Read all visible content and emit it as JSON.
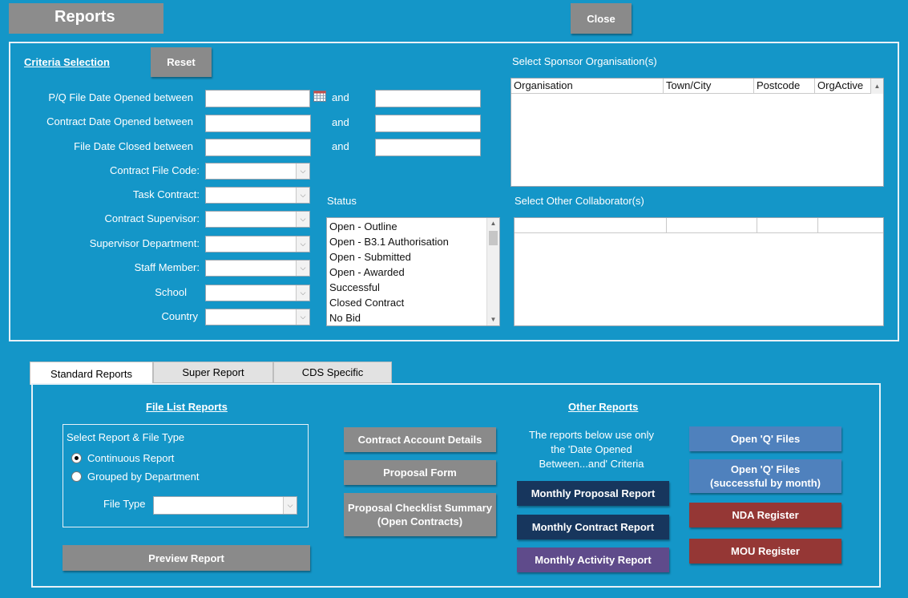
{
  "window": {
    "title": "Reports",
    "close_label": "Close"
  },
  "criteria": {
    "title": "Criteria Selection",
    "reset_label": "Reset",
    "fields": {
      "pq_date": "P/Q File Date Opened between",
      "contract_date": "Contract Date Opened between",
      "closed_date": "File Date Closed between",
      "and": "and",
      "contract_file_code": "Contract File Code:",
      "task_contract": "Task Contract:",
      "contract_supervisor": "Contract Supervisor:",
      "supervisor_department": "Supervisor Department:",
      "staff_member": "Staff Member:",
      "school": "School",
      "country": "Country"
    },
    "status": {
      "label": "Status",
      "items": [
        "Open - Outline",
        "Open - B3.1 Authorisation",
        "Open - Submitted",
        "Open - Awarded",
        "Successful",
        "Closed Contract",
        "No Bid"
      ]
    },
    "sponsor": {
      "label": "Select Sponsor Organisation(s)",
      "columns": [
        "Organisation",
        "Town/City",
        "Postcode",
        "OrgActive"
      ]
    },
    "collaborator": {
      "label": "Select Other Collaborator(s)"
    }
  },
  "tabs": [
    "Standard Reports",
    "Super Report",
    "CDS Specific"
  ],
  "file_list": {
    "title": "File List Reports",
    "group_label": "Select Report & File Type",
    "options": [
      "Continuous Report",
      "Grouped by Department"
    ],
    "file_type_label": "File Type",
    "preview_label": "Preview Report"
  },
  "middle_buttons": {
    "contract_account": "Contract Account Details",
    "proposal_form": "Proposal Form",
    "checklist_line1": "Proposal Checklist Summary",
    "checklist_line2": "(Open Contracts)"
  },
  "other_reports": {
    "title": "Other Reports",
    "note_line1": "The reports below use only",
    "note_line2": "the 'Date Opened",
    "note_line3": "Between...and' Criteria",
    "monthly_proposal": "Monthly Proposal Report",
    "monthly_contract": "Monthly Contract Report",
    "monthly_activity": "Monthly Activity Report",
    "open_q": "Open 'Q' Files",
    "open_q_success_line1": "Open 'Q' Files",
    "open_q_success_line2": "(successful by month)",
    "nda": "NDA Register",
    "mou": "MOU Register"
  },
  "colors": {
    "background": "#1496c8",
    "navy": "#17365d",
    "purple": "#5f4b8b",
    "steel": "#4f81bd",
    "red": "#953735"
  }
}
